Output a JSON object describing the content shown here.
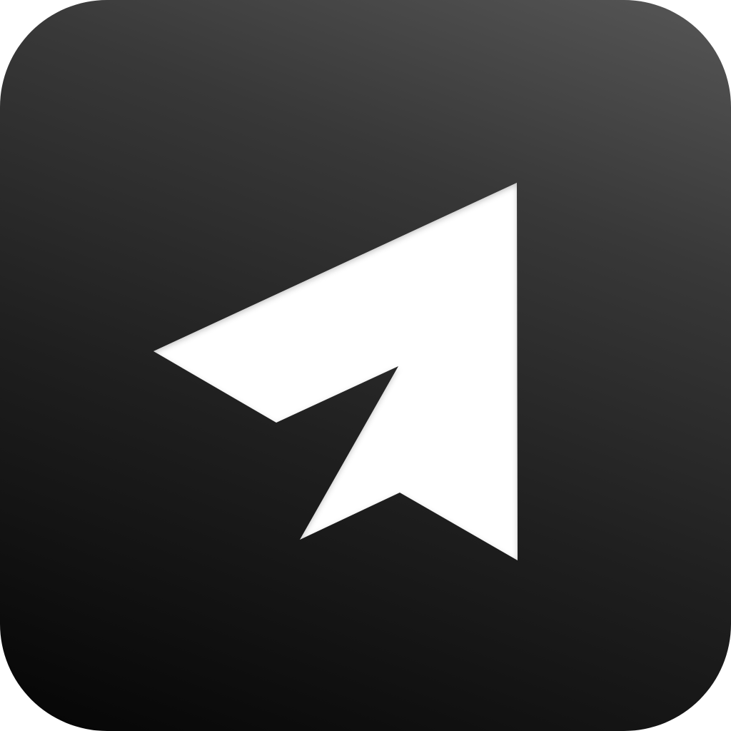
{
  "icon": {
    "name": "paper-plane",
    "glyph_color": "#ffffff",
    "background_top_color": "#565656",
    "background_bottom_color": "#050505"
  }
}
